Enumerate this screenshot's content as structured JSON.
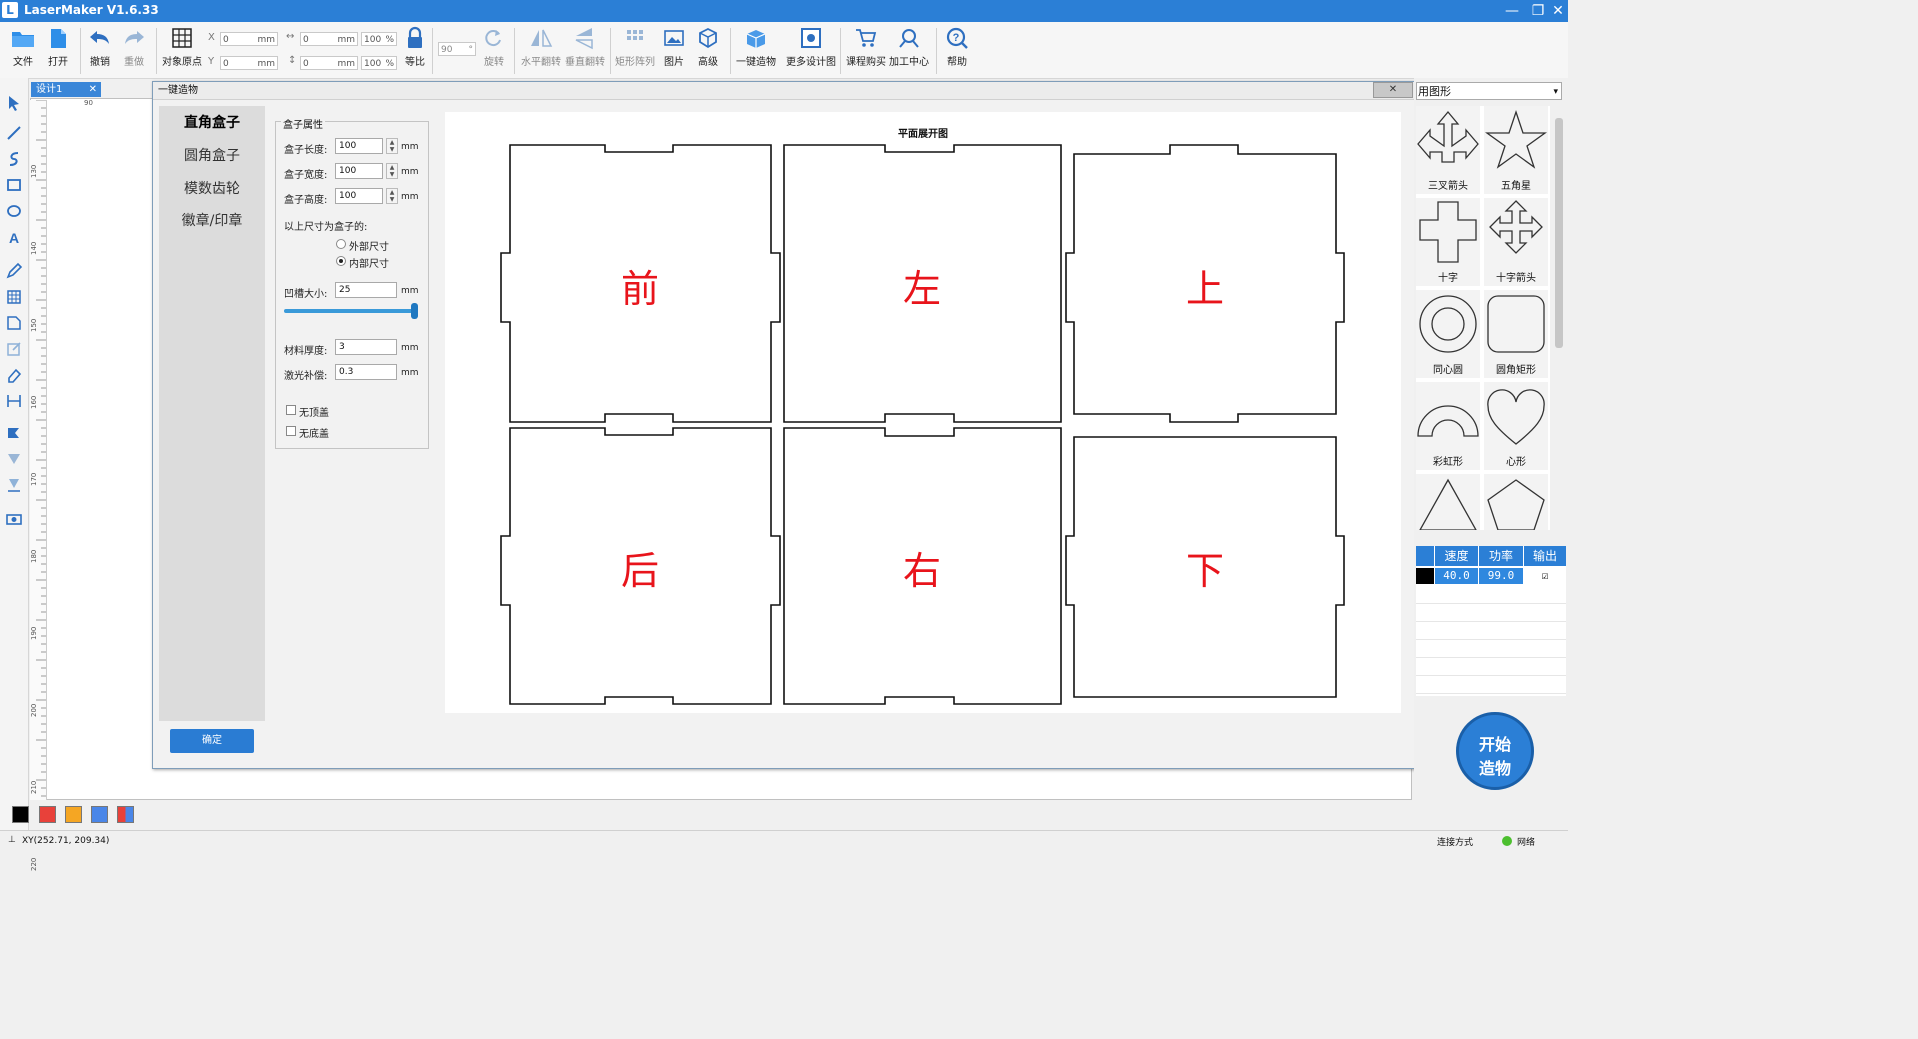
{
  "app": {
    "title": "LaserMaker V1.6.33"
  },
  "window_controls": {
    "minimize": "—",
    "restore": "❐",
    "close": "✕"
  },
  "toolbar": {
    "file": "文件",
    "open": "打开",
    "undo": "撤销",
    "redo": "重做",
    "object_origin": "对象原点",
    "x_label": "X",
    "y_label": "Y",
    "x_value": "0",
    "y_value": "0",
    "w_value": "0",
    "h_value": "0",
    "unit_mm": "mm",
    "scale_w": "100",
    "scale_h": "100",
    "pct": "%",
    "ratio": "等比",
    "rotate_value": "90",
    "degree": "°",
    "rotate": "旋转",
    "flip_h": "水平翻转",
    "flip_v": "垂直翻转",
    "array": "矩形阵列",
    "image": "图片",
    "advanced": "高级",
    "one_key": "一键造物",
    "more_designs": "更多设计图",
    "course_buy": "课程购买",
    "process_center": "加工中心",
    "help": "帮助"
  },
  "document_tab": {
    "label": "设计1",
    "close": "✕"
  },
  "ruler": {
    "top_mark": "90",
    "marks": [
      "130",
      "140",
      "150",
      "160",
      "170",
      "180",
      "190",
      "200",
      "210",
      "220"
    ]
  },
  "dialog": {
    "title": "一键造物",
    "close": "✕",
    "nav": [
      "直角盒子",
      "圆角盒子",
      "模数齿轮",
      "徽章/印章"
    ],
    "props_group": "盒子属性",
    "length_label": "盒子长度:",
    "length_value": "100",
    "width_label": "盒子宽度:",
    "width_value": "100",
    "height_label": "盒子高度:",
    "height_value": "100",
    "unit": "mm",
    "size_mode_label": "以上尺寸为盒子的:",
    "outer_size": "外部尺寸",
    "inner_size": "内部尺寸",
    "inner_selected": true,
    "notch_label": "凹槽大小:",
    "notch_value": "25",
    "notch_slider_fraction": 1.0,
    "thickness_label": "材料厚度:",
    "thickness_value": "3",
    "kerf_label": "激光补偿:",
    "kerf_value": "0.3",
    "no_top": "无顶盖",
    "no_bottom": "无底盖",
    "ok": "确定",
    "preview_title": "平面展开图",
    "faces": [
      "前",
      "左",
      "上",
      "后",
      "右",
      "下"
    ],
    "face_color": "#e8141b"
  },
  "right_panel": {
    "combo_value": "用图形",
    "shapes": [
      "三叉箭头",
      "五角星",
      "十字",
      "十字箭头",
      "同心圆",
      "圆角矩形",
      "彩虹形",
      "心形"
    ],
    "layer_headers": [
      "速度",
      "功率",
      "输出"
    ],
    "layer_row": {
      "speed": "40.0",
      "power": "99.0",
      "output_checked": "☑"
    },
    "start_button": [
      "开始",
      "造物"
    ]
  },
  "palette": {
    "colors": [
      "#000000",
      "#e8413a",
      "#f5a623",
      "#4a86e8",
      "multi"
    ]
  },
  "status": {
    "coords": "XY(252.71, 209.34)",
    "connection_label": "连接方式",
    "network": "网络"
  }
}
